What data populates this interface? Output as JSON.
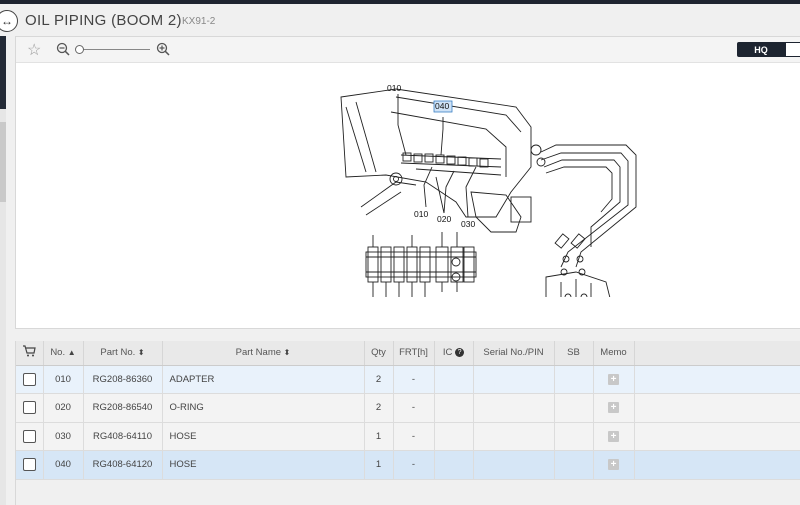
{
  "window": {
    "title": "OIL PIPING (BOOM 2)",
    "model": "KX91-2",
    "toggle_icon": "expand-arrows-icon"
  },
  "toolbar": {
    "favorite_icon": "star-icon",
    "zoom_out_icon": "zoom-out-icon",
    "zoom_in_icon": "zoom-in-icon",
    "hq_label": "HQ"
  },
  "diagram": {
    "callout_top": "010",
    "callout_highlight": "040",
    "callout_bottom_left": "010",
    "callout_bottom_mid": "020",
    "callout_bottom_right": "030"
  },
  "table": {
    "columns": {
      "cart": "",
      "no": "No.",
      "part_no": "Part No.",
      "part_name": "Part Name",
      "qty": "Qty",
      "frt": "FRT[h]",
      "ic": "IC",
      "serial": "Serial No./PIN",
      "sb": "SB",
      "memo": "Memo"
    },
    "rows": [
      {
        "no": "010",
        "part_no": "RG208-86360",
        "part_name": "ADAPTER",
        "qty": "2",
        "frt": "-",
        "ic": "",
        "serial": "",
        "sb": ""
      },
      {
        "no": "020",
        "part_no": "RG208-86540",
        "part_name": "O-RING",
        "qty": "2",
        "frt": "-",
        "ic": "",
        "serial": "",
        "sb": ""
      },
      {
        "no": "030",
        "part_no": "RG408-64110",
        "part_name": "HOSE",
        "qty": "1",
        "frt": "-",
        "ic": "",
        "serial": "",
        "sb": ""
      },
      {
        "no": "040",
        "part_no": "RG408-64120",
        "part_name": "HOSE",
        "qty": "1",
        "frt": "-",
        "ic": "",
        "serial": "",
        "sb": ""
      }
    ]
  },
  "colors": {
    "accent_dark": "#1d2430",
    "row_highlight": "#d6e6f6",
    "callout_highlight": "#cfe3f7"
  }
}
